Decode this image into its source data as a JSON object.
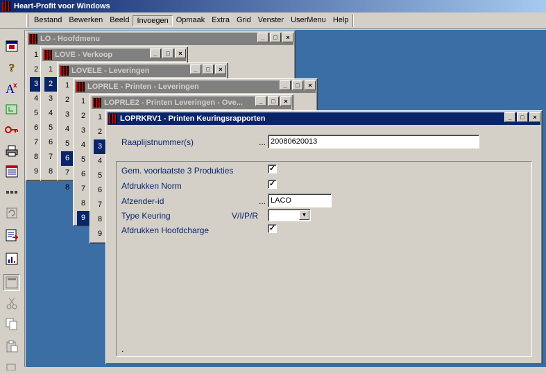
{
  "app": {
    "title": "Heart-Profit voor Windows"
  },
  "menu": [
    "Bestand",
    "Bewerken",
    "Beeld",
    "Invoegen",
    "Opmaak",
    "Extra",
    "Grid",
    "Venster",
    "UserMenu",
    "Help"
  ],
  "toolbar_icons": [
    "window-icon",
    "help-icon",
    "font-icon",
    "tree-icon",
    "key-icon",
    "printer-icon",
    "form-icon",
    "dots-icon",
    "refresh-icon",
    "export-icon",
    "chart-icon",
    "frame-icon",
    "cut-icon",
    "copy-icon",
    "paste-icon"
  ],
  "windows": {
    "lo": {
      "title": "LO - Hoofdmenu",
      "numbers": [
        "1",
        "2",
        "3",
        "4",
        "5",
        "6",
        "7",
        "8",
        "9"
      ],
      "selected": "3"
    },
    "love": {
      "title": "LOVE - Verkoop",
      "numbers": [
        "1",
        "2",
        "3",
        "4",
        "5",
        "6",
        "7",
        "8"
      ],
      "selected": "2"
    },
    "lovele": {
      "title": "LOVELE - Leveringen",
      "numbers": [
        "1",
        "2",
        "3",
        "4",
        "5",
        "6",
        "7",
        "8"
      ],
      "selected": "6"
    },
    "loprle": {
      "title": "LOPRLE - Printen - Leveringen",
      "numbers": [
        "1",
        "2",
        "3",
        "4",
        "5",
        "6",
        "7",
        "8",
        "9"
      ],
      "selected": "9"
    },
    "loprle2": {
      "title": "LOPRLE2 - Printen Leveringen - Ove...",
      "numbers": [
        "1",
        "2",
        "3",
        "4",
        "5",
        "6",
        "7",
        "8",
        "9"
      ],
      "selected": "3"
    },
    "loprkrv1": {
      "title": "LOPRKRV1 - Printen Keuringsrapporten",
      "raaplijst_label": "Raaplijstnummer(s)",
      "raaplijst_value": "20080620013",
      "gem_label": "Gem. voorlaatste 3 Produkties",
      "norm_label": "Afdrukken Norm",
      "afzender_label": "Afzender-id",
      "afzender_value": "LACO",
      "type_label": "Type Keuring",
      "type_hint": "V/I/P/R",
      "type_value": "",
      "hoofdcharge_label": "Afdrukken Hoofdcharge",
      "checks": {
        "gem": true,
        "norm": true,
        "hoofdcharge": true
      },
      "dots": "...",
      "footer_dot": "."
    }
  }
}
